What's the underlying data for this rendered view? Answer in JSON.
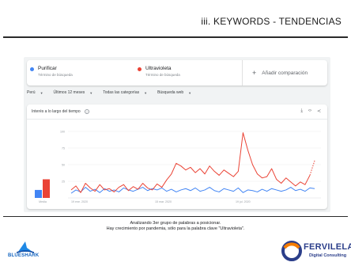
{
  "slide": {
    "title": "iii. KEYWORDS - TENDENCIAS",
    "caption_line1": "Analizando 3er grupo de palabras a posicionar.",
    "caption_line2": "Hay crecimiento por pandemia, sólo para la palabra clave \"Ultravioleta\"."
  },
  "trends": {
    "terms": [
      {
        "name": "Purificar",
        "subtitle": "Término de búsqueda",
        "color": "#4285f4"
      },
      {
        "name": "Ultravioleta",
        "subtitle": "Término de búsqueda",
        "color": "#ea4335"
      }
    ],
    "add_label": "Añadir comparación",
    "filters": [
      "Perú",
      "Últimos 12 meses",
      "Todas las categorías",
      "Búsqueda web"
    ],
    "chart_header": "Interés a lo largo del tiempo",
    "tools": [
      "download-icon",
      "embed-icon",
      "share-icon"
    ]
  },
  "chart_data": {
    "type": "line",
    "title": "Interés a lo largo del tiempo",
    "y_ticks": [
      "100",
      "75",
      "50",
      "25"
    ],
    "ylim": [
      0,
      100
    ],
    "x_tick_labels": [
      "19 ene. 2020",
      "15 mar. 2020",
      "19 jul. 2020"
    ],
    "average_label": "Media",
    "averages": [
      {
        "name": "Purificar",
        "value": 12
      },
      {
        "name": "Ultravioleta",
        "value": 28
      }
    ],
    "grid": true,
    "series": [
      {
        "name": "Purificar",
        "color": "#4285f4",
        "values": [
          7,
          12,
          9,
          16,
          10,
          13,
          8,
          14,
          10,
          12,
          9,
          15,
          12,
          10,
          13,
          16,
          11,
          14,
          12,
          15,
          10,
          13,
          9,
          12,
          14,
          11,
          15,
          10,
          12,
          16,
          11,
          9,
          14,
          12,
          10,
          15,
          8,
          12,
          11,
          9,
          13,
          10,
          14,
          12,
          10,
          12,
          16,
          11,
          13,
          10,
          15,
          14
        ]
      },
      {
        "name": "Ultravioleta",
        "color": "#ea4335",
        "values": [
          12,
          18,
          8,
          22,
          15,
          10,
          20,
          12,
          14,
          9,
          16,
          20,
          11,
          17,
          13,
          22,
          15,
          12,
          21,
          16,
          27,
          36,
          52,
          48,
          42,
          46,
          38,
          44,
          36,
          48,
          40,
          34,
          42,
          37,
          32,
          40,
          98,
          72,
          50,
          36,
          30,
          32,
          44,
          28,
          22,
          30,
          24,
          18,
          24,
          20,
          34,
          56
        ],
        "last_segment_dashed": true
      }
    ]
  }
}
